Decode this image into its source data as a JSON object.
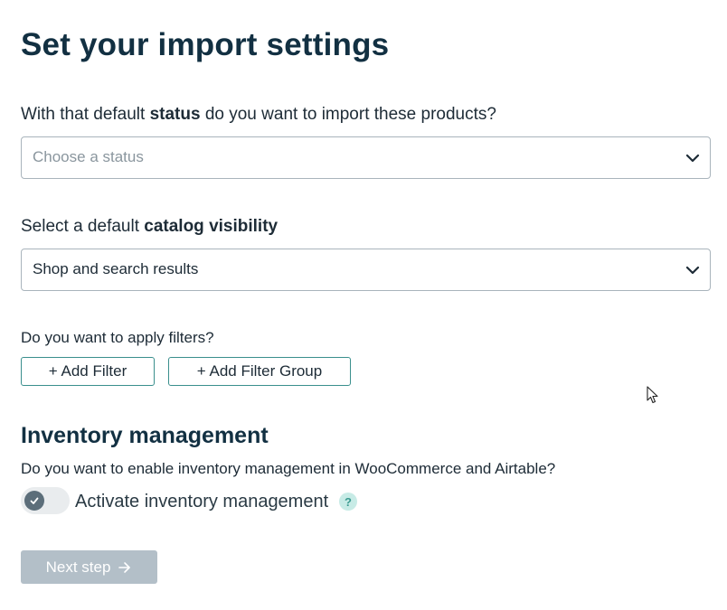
{
  "title": "Set your import settings",
  "status_question": {
    "prefix": "With that default ",
    "bold": "status",
    "suffix": " do you want to import these products?",
    "placeholder": "Choose a status"
  },
  "visibility_question": {
    "prefix": "Select a default ",
    "bold": "catalog visibility",
    "value": "Shop and search results"
  },
  "filters": {
    "label": "Do you want to apply filters?",
    "add_filter": "+ Add Filter",
    "add_filter_group": "+ Add Filter Group"
  },
  "inventory": {
    "heading": "Inventory management",
    "description": "Do you want to enable inventory management in WooCommerce and Airtable?",
    "toggle_label": "Activate inventory management",
    "help": "?"
  },
  "next_step": "Next step",
  "colors": {
    "heading": "#123042",
    "accent_border": "#3a8f8d",
    "disabled_button": "#b3bfc8",
    "help_bg": "#c7ebe6"
  },
  "icons": [
    "chevron-down-icon",
    "check-icon",
    "help-icon",
    "arrow-right-icon",
    "mouse-cursor-icon"
  ]
}
